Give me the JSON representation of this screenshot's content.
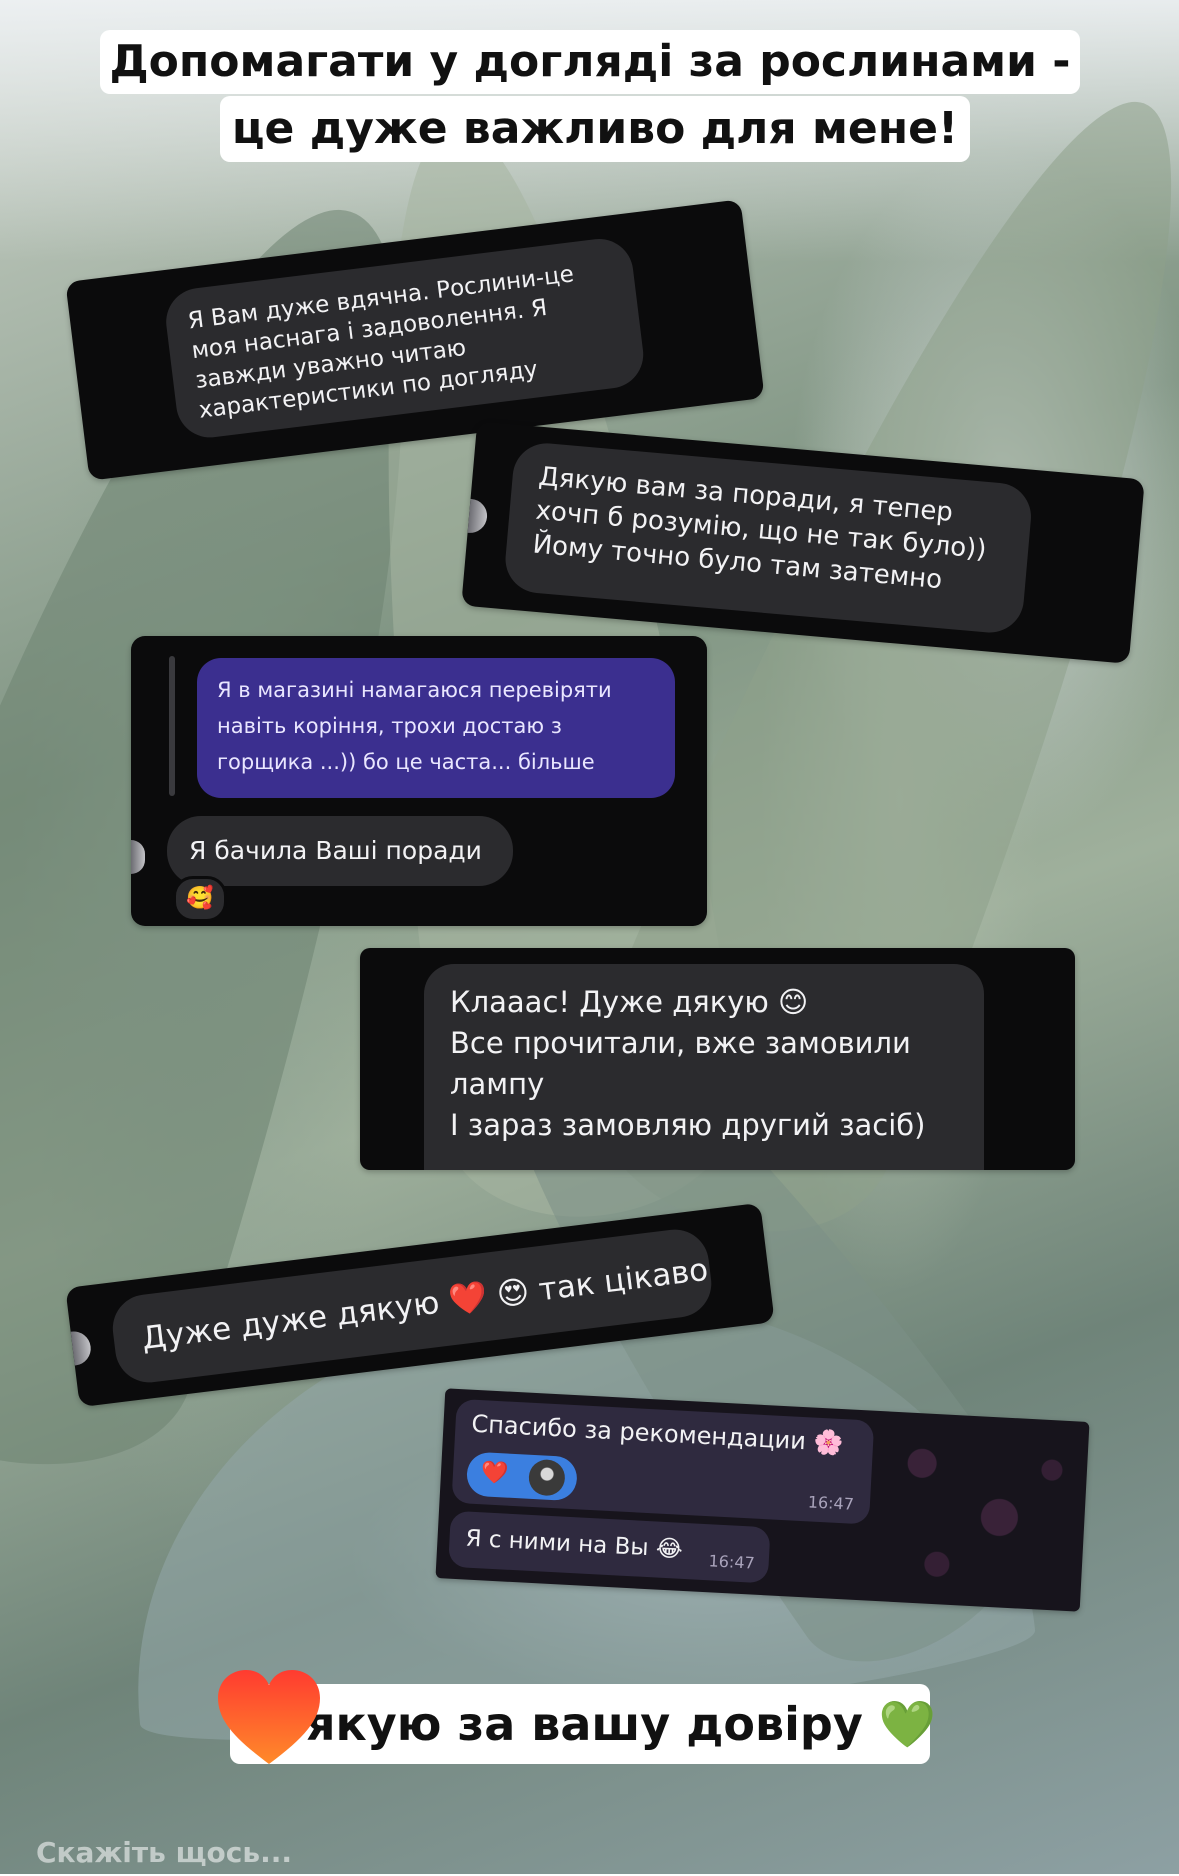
{
  "header": {
    "line1": "Допомагати у догляді за рослинами -",
    "line2": "це дуже важливо для мене!"
  },
  "messages": [
    {
      "text_lines": [
        "Я Вам дуже вдячна. Рослини-це",
        "моя наснага і задоволення. Я",
        "завжди уважно читаю",
        "характеристики по догляду"
      ]
    },
    {
      "text_lines": [
        "Дякую вам за поради, я тепер",
        "хочп б розумію, що не так було))",
        "Йому точно було там затемно"
      ]
    },
    {
      "reply_lines": [
        "Я в магазині намагаюся перевіряти",
        "навіть коріння, трохи достаю з",
        "горщика ...)) бо це часта... більше"
      ],
      "text": "Я бачила Ваші поради",
      "reaction": "🥰"
    },
    {
      "text_lines": [
        "Клааас! Дуже дякую 😊",
        "Все прочитали, вже замовили",
        "лампу",
        "І зараз замовляю другий засіб)"
      ]
    },
    {
      "text": "Дуже дуже дякую ❤️ 😍 так цікаво"
    },
    {
      "text1": "Спасибо за рекомендации 🌸",
      "reaction": "❤️",
      "time1": "16:47",
      "text2": "Я с ними на Вы 😂",
      "time2": "16:47"
    }
  ],
  "footer_caption": "Дякую за вашу довіру 💚",
  "footer_caption_visible": "якую за вашу довіру 💚",
  "reply_input": {
    "placeholder": "Скажіть щось..."
  },
  "colors": {
    "chat_bg": "#0b0b0c",
    "bubble": "#2b2b2e",
    "reply_bubble": "#3b2f8f",
    "telegram_bubble": "#2f2a3f",
    "telegram_reaction": "#3b7fe0"
  }
}
